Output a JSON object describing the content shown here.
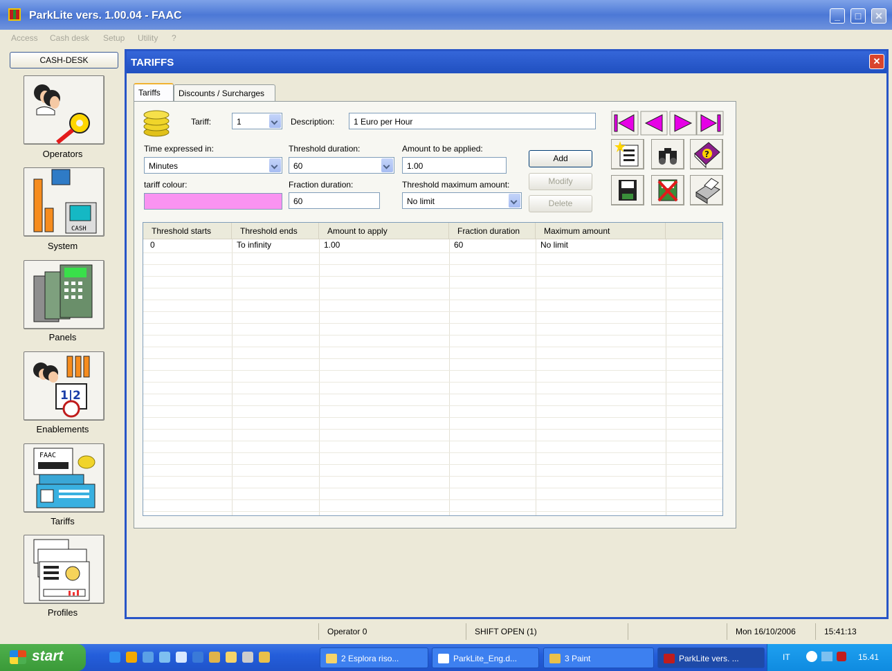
{
  "app": {
    "title": "ParkLite vers. 1.00.04 - FAAC",
    "window_buttons": {
      "minimize": "_",
      "maximize": "□",
      "close": "✕"
    }
  },
  "menu": [
    "Access",
    "Cash desk",
    "Setup",
    "Utility",
    "?"
  ],
  "sidebar": {
    "cash_desk_label": "CASH-DESK",
    "items": [
      {
        "label": "Operators",
        "icon": "operators-icon"
      },
      {
        "label": "System",
        "icon": "system-icon",
        "icon_text": "CASH"
      },
      {
        "label": "Panels",
        "icon": "panels-icon"
      },
      {
        "label": "Enablements",
        "icon": "enablements-icon",
        "icon_text": "1|2"
      },
      {
        "label": "Tariffs",
        "icon": "tariffs-icon",
        "icon_text": "FAAC"
      },
      {
        "label": "Profiles",
        "icon": "profiles-icon"
      }
    ]
  },
  "child_window": {
    "title": "TARIFFS",
    "close": "✕",
    "tabs": [
      "Tariffs",
      "Discounts / Surcharges"
    ],
    "form": {
      "tariff_label": "Tariff:",
      "tariff_value": "1",
      "description_label": "Description:",
      "description_value": "1 Euro per Hour",
      "time_label": "Time expressed in:",
      "time_value": "Minutes",
      "threshold_duration_label": "Threshold duration:",
      "threshold_duration_value": "60",
      "amount_label": "Amount to be applied:",
      "amount_value": "1.00",
      "colour_label": "tariff colour:",
      "colour_value": "#f993f1",
      "fraction_label": "Fraction duration:",
      "fraction_value": "60",
      "max_amount_label": "Threshold maximum amount:",
      "max_amount_value": "No limit"
    },
    "buttons": {
      "add": "Add",
      "modify": "Modify",
      "delete": "Delete"
    },
    "toolbar_icons": [
      "first-record-icon",
      "previous-record-icon",
      "next-record-icon",
      "last-record-icon",
      "new-record-icon",
      "search-binoculars-icon",
      "help-book-icon",
      "save-disk-icon",
      "cancel-icon",
      "print-icon"
    ],
    "grid": {
      "columns": [
        "Threshold starts",
        "Threshold ends",
        "Amount to apply",
        "Fraction duration",
        "Maximum amount"
      ],
      "rows": [
        [
          "0",
          "To infinity",
          "1.00",
          "60",
          "No limit"
        ]
      ]
    }
  },
  "statusbar": {
    "operator": "Operator 0",
    "shift": "SHIFT OPEN (1)",
    "date": "Mon 16/10/2006",
    "time": "15:41:13"
  },
  "taskbar": {
    "start_label": "start",
    "tasks": [
      "2 Esplora riso...",
      "ParkLite_Eng.d...",
      "3 Paint",
      "ParkLite vers. ..."
    ],
    "tray_lang": "IT",
    "tray_clock": "15.41"
  },
  "colors": {
    "titlebar": "#4c78d6",
    "child_titlebar": "#2855c7",
    "accent_pink": "#e600e6",
    "tariff_colour": "#f993f1"
  }
}
